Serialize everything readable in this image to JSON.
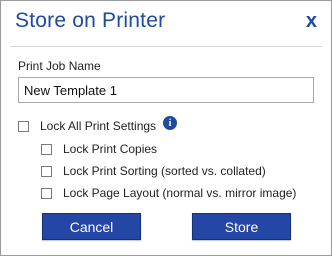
{
  "dialog": {
    "title": "Store on Printer",
    "close_label": "x"
  },
  "print_job": {
    "label": "Print Job Name",
    "value": "New Template 1"
  },
  "options": {
    "lock_all": {
      "label": "Lock All Print Settings",
      "checked": false
    },
    "lock_copies": {
      "label": "Lock Print Copies",
      "checked": false
    },
    "lock_sorting": {
      "label": "Lock Print Sorting (sorted vs. collated)",
      "checked": false
    },
    "lock_layout": {
      "label": "Lock Page Layout (normal vs. mirror image)",
      "checked": false
    },
    "info_icon": "info-icon"
  },
  "buttons": {
    "cancel": "Cancel",
    "store": "Store"
  },
  "colors": {
    "accent": "#1f4aa0",
    "button_bg": "#2447a6",
    "border": "#9a9a9a"
  }
}
